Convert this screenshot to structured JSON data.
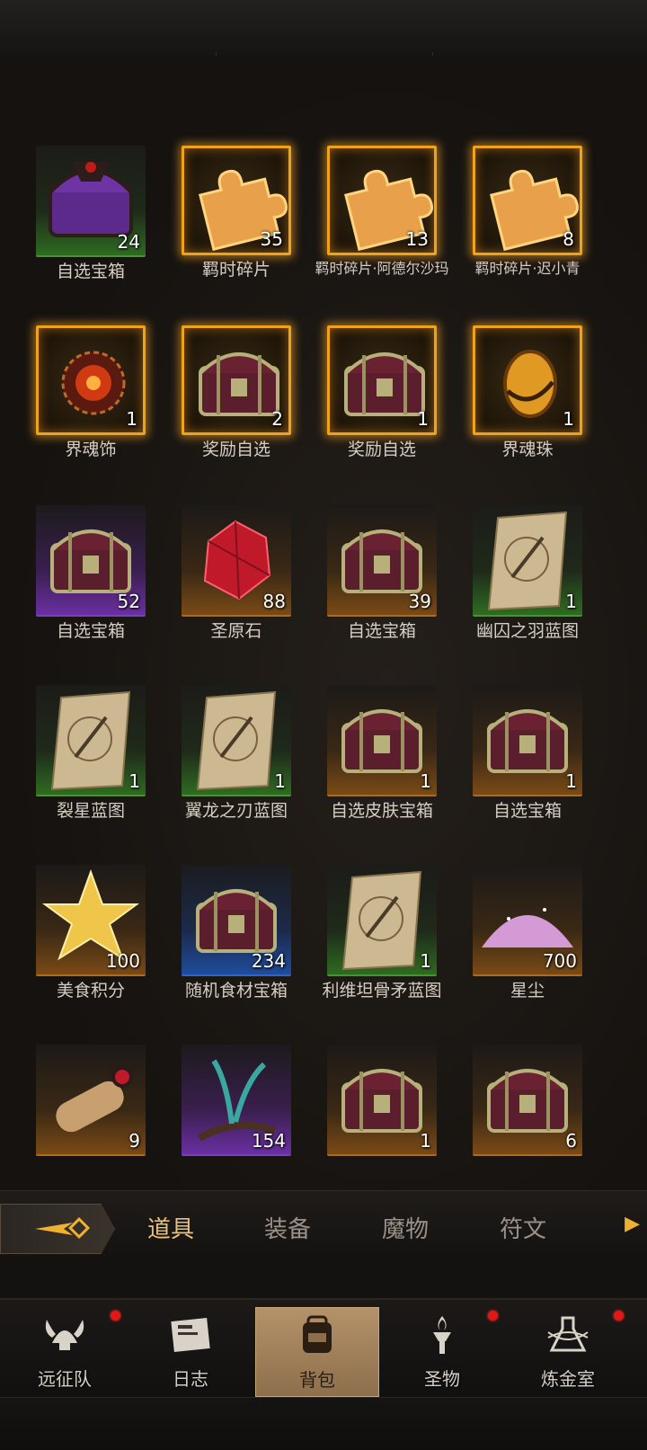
{
  "items": [
    {
      "name": "自选宝箱",
      "count": "24",
      "rarity": "green",
      "icon": "purple-chest-icon"
    },
    {
      "name": "羁时碎片",
      "count": "35",
      "rarity": "gold",
      "icon": "puzzle-piece-icon"
    },
    {
      "name": "羁时碎片·阿德尔沙玛",
      "count": "13",
      "rarity": "gold",
      "icon": "puzzle-piece-icon"
    },
    {
      "name": "羁时碎片·迟小青",
      "count": "8",
      "rarity": "gold",
      "icon": "puzzle-piece-icon"
    },
    {
      "name": "界魂饰",
      "count": "1",
      "rarity": "gold",
      "icon": "sun-ornament-icon"
    },
    {
      "name": "奖励自选",
      "count": "2",
      "rarity": "gold",
      "icon": "treasure-chest-icon"
    },
    {
      "name": "奖励自选",
      "count": "1",
      "rarity": "gold",
      "icon": "treasure-chest-icon"
    },
    {
      "name": "界魂珠",
      "count": "1",
      "rarity": "gold",
      "icon": "soul-orb-icon"
    },
    {
      "name": "自选宝箱",
      "count": "52",
      "rarity": "purple",
      "icon": "treasure-chest-icon"
    },
    {
      "name": "圣原石",
      "count": "88",
      "rarity": "orange",
      "icon": "red-crystal-icon"
    },
    {
      "name": "自选宝箱",
      "count": "39",
      "rarity": "orange",
      "icon": "treasure-chest-icon"
    },
    {
      "name": "幽囚之羽蓝图",
      "count": "1",
      "rarity": "green",
      "icon": "blueprint-scroll-icon"
    },
    {
      "name": "裂星蓝图",
      "count": "1",
      "rarity": "green",
      "icon": "blueprint-scroll-icon"
    },
    {
      "name": "翼龙之刃蓝图",
      "count": "1",
      "rarity": "green",
      "icon": "blueprint-scroll-icon"
    },
    {
      "name": "自选皮肤宝箱",
      "count": "1",
      "rarity": "orange",
      "icon": "treasure-chest-icon"
    },
    {
      "name": "自选宝箱",
      "count": "1",
      "rarity": "orange",
      "icon": "treasure-chest-icon"
    },
    {
      "name": "美食积分",
      "count": "100",
      "rarity": "orange",
      "icon": "gold-star-icon"
    },
    {
      "name": "随机食材宝箱",
      "count": "234",
      "rarity": "blue",
      "icon": "treasure-chest-icon"
    },
    {
      "name": "利维坦骨矛蓝图",
      "count": "1",
      "rarity": "green",
      "icon": "blueprint-scroll-icon"
    },
    {
      "name": "星尘",
      "count": "700",
      "rarity": "orange",
      "icon": "stardust-icon"
    },
    {
      "name": "",
      "count": "9",
      "rarity": "orange",
      "icon": "rolled-scroll-icon"
    },
    {
      "name": "",
      "count": "154",
      "rarity": "purple",
      "icon": "branch-icon"
    },
    {
      "name": "",
      "count": "1",
      "rarity": "orange",
      "icon": "treasure-chest-icon"
    },
    {
      "name": "",
      "count": "6",
      "rarity": "orange",
      "icon": "treasure-chest-icon"
    }
  ],
  "tabs": {
    "items": [
      {
        "label": "道具"
      },
      {
        "label": "装备"
      },
      {
        "label": "魔物"
      },
      {
        "label": "符文"
      }
    ],
    "active": "道具"
  },
  "nav": {
    "items": [
      {
        "label": "远征队",
        "icon": "viking-helmet-icon",
        "badge": true
      },
      {
        "label": "日志",
        "icon": "journal-icon",
        "badge": false
      },
      {
        "label": "背包",
        "icon": "backpack-icon",
        "badge": false
      },
      {
        "label": "圣物",
        "icon": "torch-icon",
        "badge": true
      },
      {
        "label": "炼金室",
        "icon": "alchemy-icon",
        "badge": true
      }
    ],
    "active": "背包"
  },
  "colors": {
    "gold_frame": "#f0a21a",
    "active_tab": "#e8c27a",
    "badge": "#e01818"
  }
}
